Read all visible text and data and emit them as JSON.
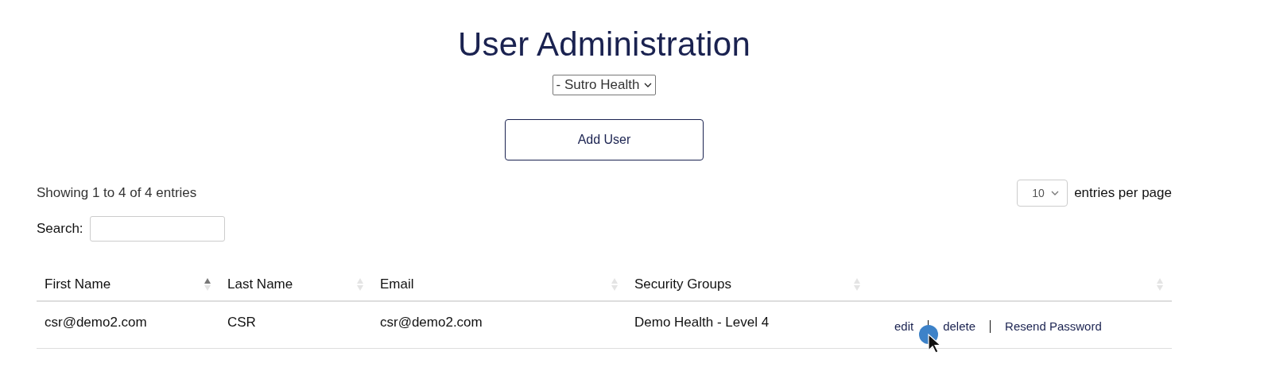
{
  "title": "User Administration",
  "organization_select": {
    "value": "- Sutro Health"
  },
  "add_button": "Add User",
  "summary": "Showing 1 to 4 of 4 entries",
  "page_size": {
    "value": "10",
    "label": "entries per page"
  },
  "search": {
    "label": "Search:"
  },
  "table": {
    "columns": [
      {
        "label": "First Name",
        "sorted": true
      },
      {
        "label": "Last Name",
        "sorted": false
      },
      {
        "label": "Email",
        "sorted": false
      },
      {
        "label": "Security Groups",
        "sorted": false
      },
      {
        "sorted": false
      }
    ],
    "rows": [
      {
        "first_name": "csr@demo2.com",
        "last_name": "CSR",
        "email": "csr@demo2.com",
        "security_groups": "Demo Health - Level 4",
        "actions": [
          "edit",
          "delete",
          "Resend Password"
        ]
      }
    ]
  }
}
